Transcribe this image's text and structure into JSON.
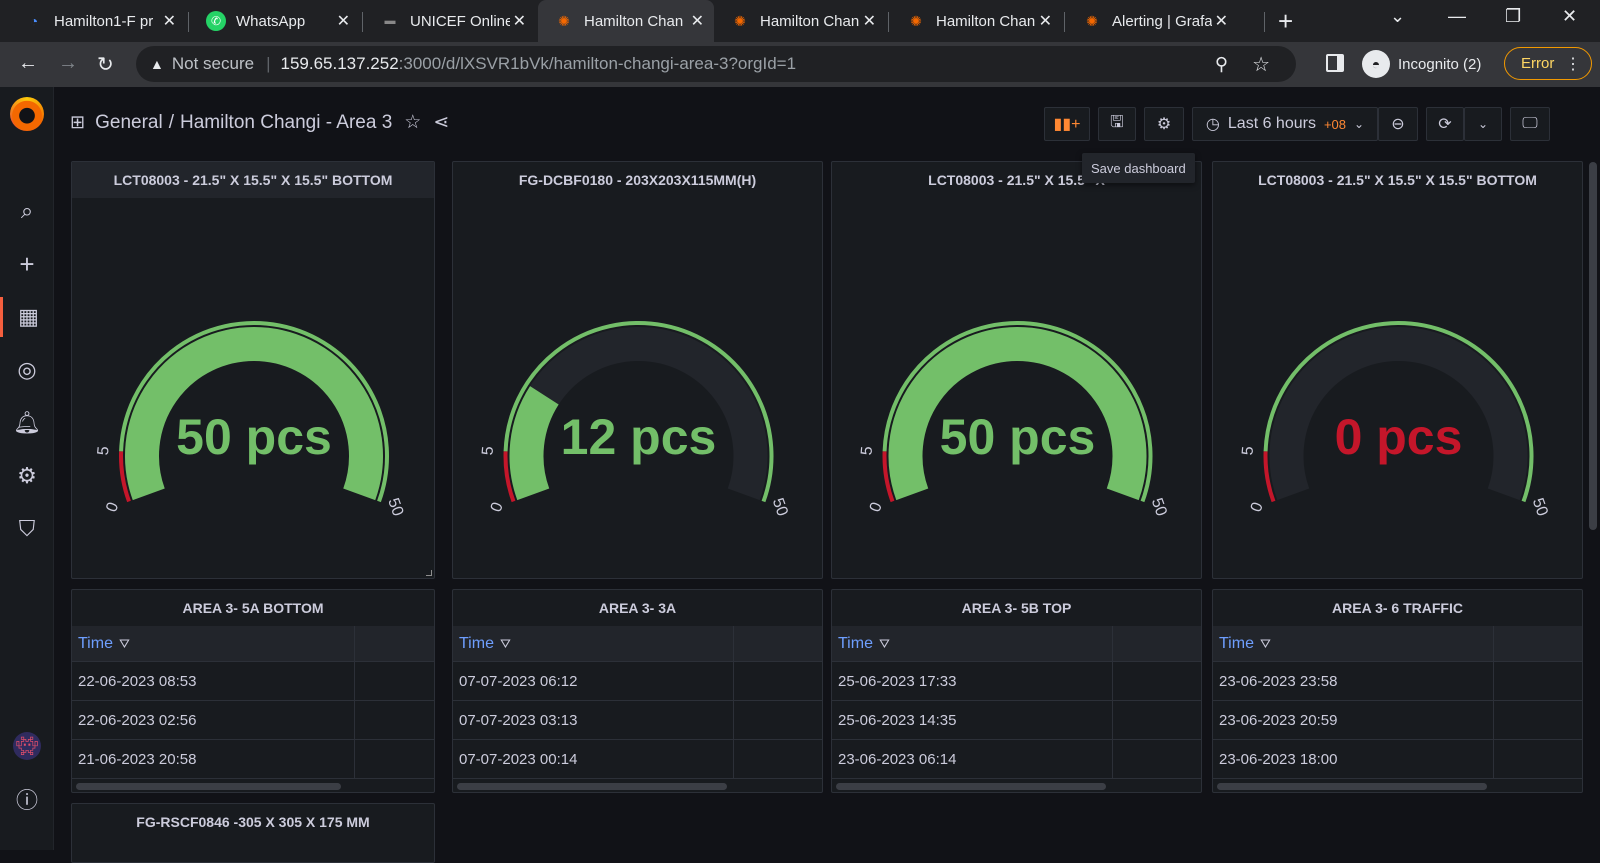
{
  "browser": {
    "tabs": [
      {
        "title": "Hamilton1-F pr",
        "icon": "grafana-blue-icon",
        "active": false
      },
      {
        "title": "WhatsApp",
        "icon": "whatsapp-icon",
        "active": false
      },
      {
        "title": "UNICEF Online",
        "icon": "unicef-icon",
        "active": false
      },
      {
        "title": "Hamilton Chan",
        "icon": "grafana-icon",
        "active": true
      },
      {
        "title": "Hamilton Chan",
        "icon": "grafana-icon",
        "active": false
      },
      {
        "title": "Hamilton Chan",
        "icon": "grafana-icon",
        "active": false
      },
      {
        "title": "Alerting | Grafa",
        "icon": "grafana-icon",
        "active": false
      }
    ],
    "security_label": "Not secure",
    "url_host": "159.65.137.252",
    "url_path": ":3000/d/lXSVR1bVk/hamilton-changi-area-3?orgId=1",
    "profile_label": "Incognito (2)",
    "error_label": "Error"
  },
  "breadcrumb": {
    "folder": "General",
    "separator": "/",
    "dashboard": "Hamilton Changi - Area 3"
  },
  "toolbar": {
    "time_range": "Last 6 hours",
    "timezone": "+08",
    "tooltip": "Save dashboard"
  },
  "gauges": [
    {
      "title": "LCT08003 - 21.5\" X 15.5\" X 15.5\" BOTTOM",
      "value": 50,
      "display": "50 pcs",
      "color": "#73bf69",
      "min": 0,
      "max": 50,
      "threshold": 5,
      "min_label": "0",
      "threshold_label": "5",
      "max_label": "50"
    },
    {
      "title": "FG-DCBF0180 - 203X203X115MM(H)",
      "value": 12,
      "display": "12 pcs",
      "color": "#73bf69",
      "min": 0,
      "max": 50,
      "threshold": 5,
      "min_label": "0",
      "threshold_label": "5",
      "max_label": "50"
    },
    {
      "title": "LCT08003 - 21.5\" X 15.5\" X ",
      "value": 50,
      "display": "50 pcs",
      "color": "#73bf69",
      "min": 0,
      "max": 50,
      "threshold": 5,
      "min_label": "0",
      "threshold_label": "5",
      "max_label": "50"
    },
    {
      "title": "LCT08003 - 21.5\" X 15.5\" X 15.5\" BOTTOM",
      "value": 0,
      "display": "0 pcs",
      "color": "#c4162a",
      "min": 0,
      "max": 50,
      "threshold": 5,
      "min_label": "0",
      "threshold_label": "5",
      "max_label": "50"
    }
  ],
  "tables": [
    {
      "title": "AREA 3- 5A BOTTOM",
      "column": "Time",
      "rows": [
        "22-06-2023 08:53",
        "22-06-2023 02:56",
        "21-06-2023 20:58"
      ]
    },
    {
      "title": "AREA 3- 3A",
      "column": "Time",
      "rows": [
        "07-07-2023 06:12",
        "07-07-2023 03:13",
        "07-07-2023 00:14"
      ]
    },
    {
      "title": "AREA 3- 5B TOP",
      "column": "Time",
      "rows": [
        "25-06-2023 17:33",
        "25-06-2023 14:35",
        "23-06-2023 06:14"
      ]
    },
    {
      "title": "AREA 3- 6 TRAFFIC",
      "column": "Time",
      "rows": [
        "23-06-2023 23:58",
        "23-06-2023 20:59",
        "23-06-2023 18:00"
      ]
    }
  ],
  "bottom_panel": {
    "title": "FG-RSCF0846 -305 X 305 X 175 MM"
  }
}
